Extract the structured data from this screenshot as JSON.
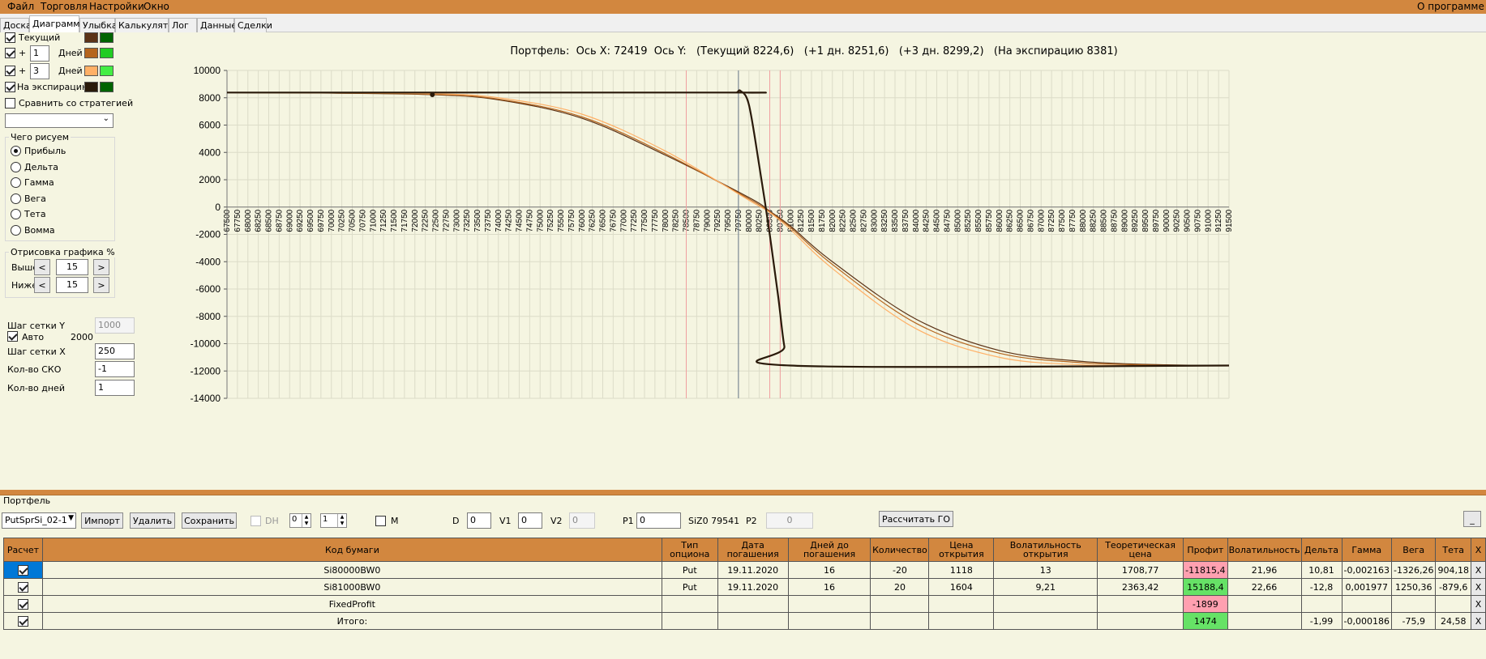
{
  "menu": {
    "items": [
      "Файл",
      "Торговля",
      "Настройки",
      "Окно"
    ],
    "about": "О программе"
  },
  "tabs": [
    "Доска",
    "Диаграмма",
    "Улыбка",
    "Калькулятор",
    "Лог",
    "Данные",
    "Сделки"
  ],
  "left": {
    "current_label": "Текущий",
    "plus": "+",
    "days1": "1",
    "days2": "3",
    "days_label": "Дней",
    "expiry_label": "На экспирацию",
    "compare_label": "Сравнить со стратегией",
    "draw_group": "Чего рисуем",
    "draw_options": [
      "Прибыль",
      "Дельта",
      "Гамма",
      "Вега",
      "Тета",
      "Вомма"
    ],
    "render_group": "Отрисовка графика %",
    "above_label": "Выше",
    "below_label": "Ниже",
    "above_value": "15",
    "below_value": "15",
    "left_arrow": "<",
    "right_arrow": ">",
    "grid_y_label": "Шаг сетки Y",
    "grid_y_value": "1000",
    "auto_label": "Авто",
    "auto_value": "2000",
    "grid_x_label": "Шаг сетки X",
    "grid_x_value": "250",
    "sko_label": "Кол-во СКО",
    "sko_value": "-1",
    "days_count_label": "Кол-во дней",
    "days_count_value": "1"
  },
  "colors": {
    "current": [
      "#5c3317",
      "#006400"
    ],
    "plus1": [
      "#b5651d",
      "#22cc22"
    ],
    "plus3": [
      "#ffb066",
      "#44ee44"
    ],
    "expiry": [
      "#2a1a0a",
      "#006400"
    ]
  },
  "chart_title": "Портфель:  Ось X: 72419  Ось Y:   (Текущий 8224,6)   (+1 дн. 8251,6)   (+3 дн. 8299,2)   (На экспирацию 8381)",
  "chart_data": {
    "type": "line",
    "xlim": [
      67500,
      91500
    ],
    "ylim": [
      -14000,
      10000
    ],
    "x_tick_step": 250,
    "y_ticks": [
      10000,
      8000,
      6000,
      4000,
      2000,
      0,
      -2000,
      -4000,
      -6000,
      -8000,
      -10000,
      -12000,
      -14000
    ],
    "grid": true,
    "cursor_x": 79750,
    "marker": [
      72419,
      8224.6
    ],
    "ref_lines": [
      78500,
      80500,
      80750
    ],
    "series": [
      {
        "name": "Текущий",
        "x": [
          67500,
          70000,
          72419,
          74000,
          76000,
          78000,
          80000,
          80500,
          81000,
          82000,
          84000,
          86000,
          88000,
          90000,
          91500
        ],
        "y": [
          8380,
          8340,
          8224.6,
          7850,
          6500,
          3800,
          700,
          -300,
          -1400,
          -4000,
          -8200,
          -10500,
          -11300,
          -11550,
          -11600
        ]
      },
      {
        "name": "+1 дн.",
        "x": [
          67500,
          70000,
          72419,
          74000,
          76000,
          78000,
          80000,
          80500,
          81000,
          82000,
          84000,
          86000,
          88000,
          90000,
          91500
        ],
        "y": [
          8380,
          8345,
          8251.6,
          7900,
          6600,
          3900,
          600,
          -350,
          -1500,
          -4200,
          -8500,
          -10700,
          -11400,
          -11580,
          -11610
        ]
      },
      {
        "name": "+3 дн.",
        "x": [
          67500,
          70000,
          72419,
          74000,
          76000,
          78000,
          80000,
          80500,
          81000,
          82000,
          84000,
          86000,
          88000,
          90000,
          91500
        ],
        "y": [
          8380,
          8360,
          8299.2,
          8000,
          6800,
          4100,
          500,
          -400,
          -1650,
          -4500,
          -8900,
          -11000,
          -11550,
          -11610,
          -11620
        ]
      },
      {
        "name": "На экспирацию",
        "x": [
          67500,
          79450,
          79700,
          79800,
          80000,
          80250,
          80500,
          80700,
          80850,
          81000,
          91500
        ],
        "y": [
          8381,
          8381,
          8381,
          8500,
          7500,
          3000,
          -2000,
          -6500,
          -10200,
          -11600,
          -11600
        ]
      }
    ]
  },
  "portfolio": {
    "label": "Портфель",
    "select_value": "PutSprSi_02-1",
    "import": "Импорт",
    "delete": "Удалить",
    "save": "Сохранить",
    "dh_label": "DH",
    "spin1": "0",
    "spin2": "1",
    "m_label": "M",
    "d_label": "D",
    "d_value": "0",
    "v1_label": "V1",
    "v1_value": "0",
    "v2_label": "V2",
    "v2_value": "0",
    "p1_label": "P1",
    "p1_value": "0",
    "siz_label": "SiZ0 79541",
    "p2_label": "P2",
    "p2_value": "0",
    "go_button": "Рассчитать ГО",
    "minimize": "_"
  },
  "table": {
    "headers": [
      "Расчет",
      "Код бумаги",
      "Тип опциона",
      "Дата погашения",
      "Дней до погашения",
      "Количество",
      "Цена открытия",
      "Волатильность открытия",
      "Теоретическая цена",
      "Профит",
      "Волатильность",
      "Дельта",
      "Гамма",
      "Вега",
      "Тета",
      "X"
    ],
    "rows": [
      [
        "",
        "Si80000BW0",
        "Put",
        "19.11.2020",
        "16",
        "-20",
        "1118",
        "13",
        "1708,77",
        "-11815,4",
        "21,96",
        "10,81",
        "-0,002163",
        "-1326,26",
        "904,18",
        "X"
      ],
      [
        "",
        "Si81000BW0",
        "Put",
        "19.11.2020",
        "16",
        "20",
        "1604",
        "9,21",
        "2363,42",
        "15188,4",
        "22,66",
        "-12,8",
        "0,001977",
        "1250,36",
        "-879,6",
        "X"
      ],
      [
        "",
        "FixedProfit",
        "",
        "",
        "",
        "",
        "",
        "",
        "",
        "-1899",
        "",
        "",
        "",
        "",
        "",
        "X"
      ],
      [
        "",
        "Итого:",
        "",
        "",
        "",
        "",
        "",
        "",
        "",
        "1474",
        "",
        "-1,99",
        "-0,000186",
        "-75,9",
        "24,58",
        "X"
      ]
    ]
  }
}
